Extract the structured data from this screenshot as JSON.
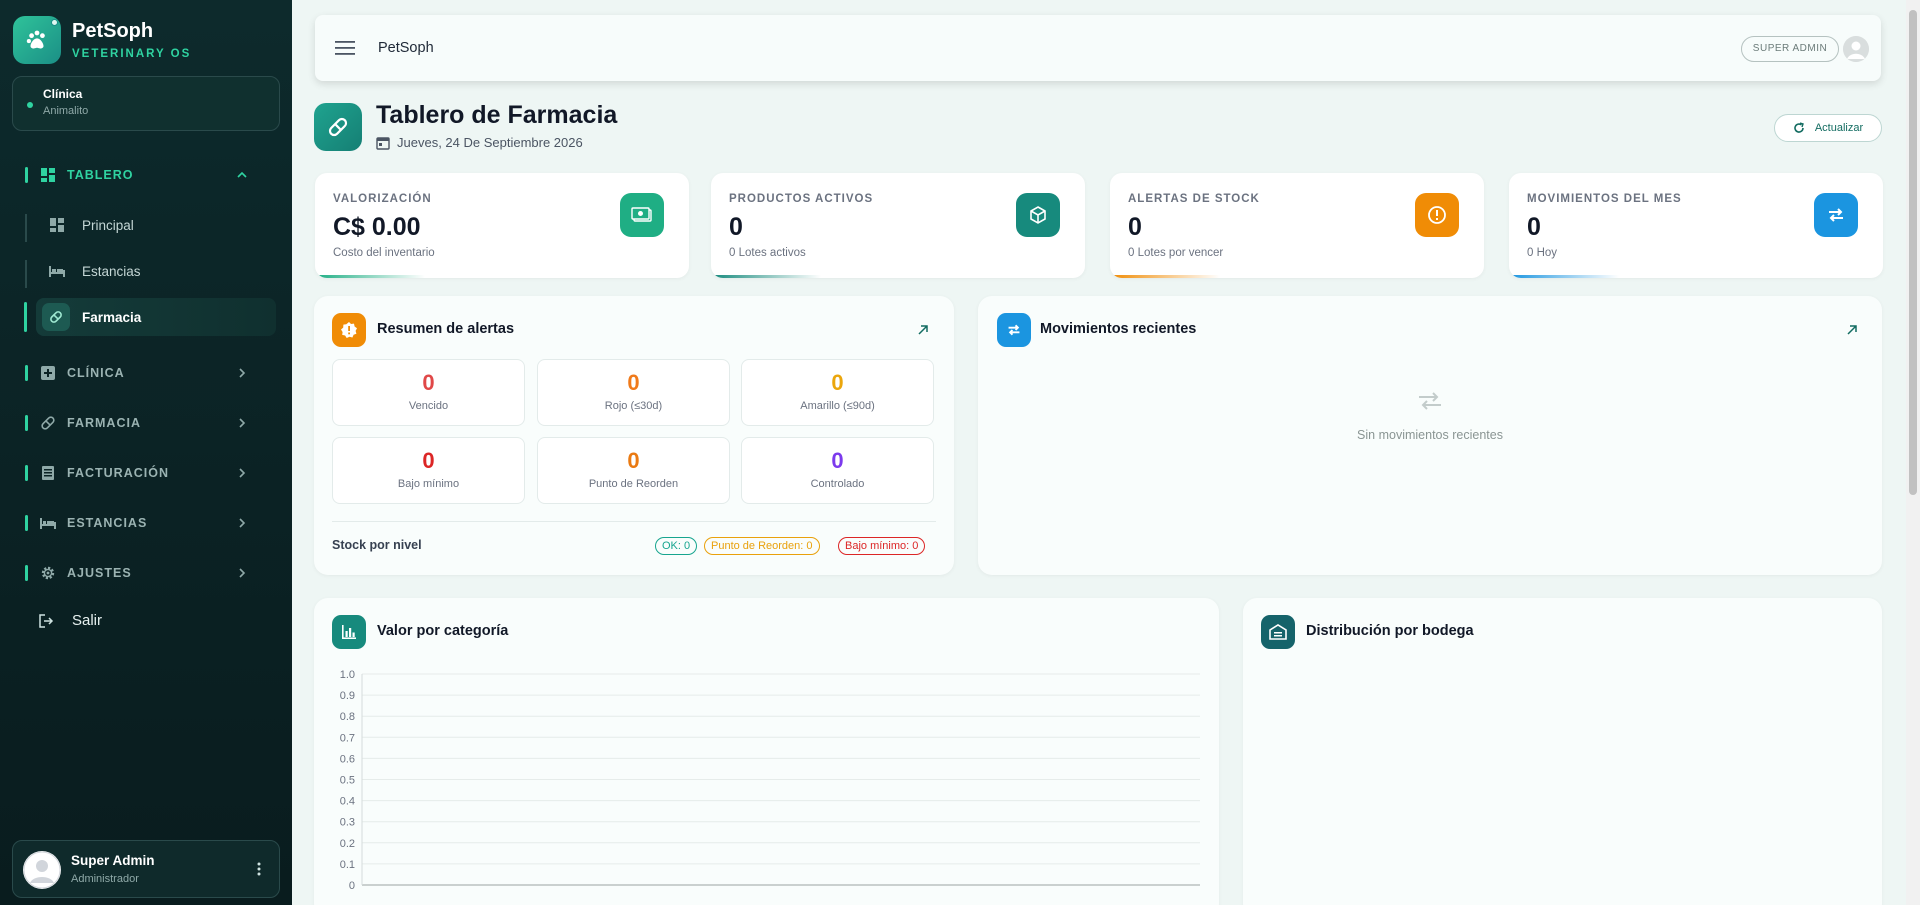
{
  "brand": {
    "name": "PetSoph",
    "subtitle": "VETERINARY OS"
  },
  "clinic": {
    "label": "Clínica",
    "name": "Animalito"
  },
  "nav": {
    "tablero": {
      "label": "TABLERO",
      "items": [
        {
          "label": "Principal"
        },
        {
          "label": "Estancias"
        },
        {
          "label": "Farmacia"
        }
      ]
    },
    "clinica": {
      "label": "CLÍNICA"
    },
    "farmacia": {
      "label": "FARMACIA"
    },
    "facturacion": {
      "label": "FACTURACIÓN"
    },
    "estancias": {
      "label": "ESTANCIAS"
    },
    "ajustes": {
      "label": "AJUSTES"
    },
    "logout": "Salir"
  },
  "user": {
    "name": "Super Admin",
    "role": "Administrador"
  },
  "topbar": {
    "title": "PetSoph",
    "role_badge": "SUPER ADMIN"
  },
  "page": {
    "title": "Tablero de Farmacia",
    "date": "Jueves, 24 De Septiembre 2026",
    "refresh": "Actualizar"
  },
  "stats": [
    {
      "label": "VALORIZACIÓN",
      "value": "C$ 0.00",
      "sub": "Costo del inventario",
      "color": "#1fae84"
    },
    {
      "label": "PRODUCTOS ACTIVOS",
      "value": "0",
      "sub": "0 Lotes activos",
      "color": "#178a7d"
    },
    {
      "label": "ALERTAS DE STOCK",
      "value": "0",
      "sub": "0 Lotes por vencer",
      "color": "#f08c06"
    },
    {
      "label": "MOVIMIENTOS DEL MES",
      "value": "0",
      "sub": "0 Hoy",
      "color": "#1b95e0"
    }
  ],
  "alerts": {
    "title": "Resumen de alertas",
    "cells": [
      {
        "value": "0",
        "label": "Vencido",
        "color": "#e04848"
      },
      {
        "value": "0",
        "label": "Rojo (≤30d)",
        "color": "#f07a1a"
      },
      {
        "value": "0",
        "label": "Amarillo (≤90d)",
        "color": "#eba60c"
      },
      {
        "value": "0",
        "label": "Bajo mínimo",
        "color": "#dc2626"
      },
      {
        "value": "0",
        "label": "Punto de Reorden",
        "color": "#ea7a12"
      },
      {
        "value": "0",
        "label": "Controlado",
        "color": "#7c3aed"
      }
    ],
    "stock_label": "Stock por nivel",
    "tags": [
      {
        "text": "OK: 0",
        "color": "#17a58f"
      },
      {
        "text": "Punto de Reorden: 0",
        "color": "#e9a10c"
      },
      {
        "text": "Bajo mínimo: 0",
        "color": "#dc2626"
      }
    ]
  },
  "movements": {
    "title": "Movimientos recientes",
    "empty": "Sin movimientos recientes"
  },
  "category_chart": {
    "title": "Valor por categoría"
  },
  "warehouse": {
    "title": "Distribución por bodega"
  },
  "chart_data": {
    "type": "bar",
    "categories": [],
    "values": [],
    "title": "Valor por categoría",
    "ylim": [
      0,
      1.0
    ],
    "yticks": [
      "1.0",
      "0.9",
      "0.8",
      "0.7",
      "0.6",
      "0.5",
      "0.4",
      "0.3",
      "0.2",
      "0.1",
      "0"
    ]
  }
}
